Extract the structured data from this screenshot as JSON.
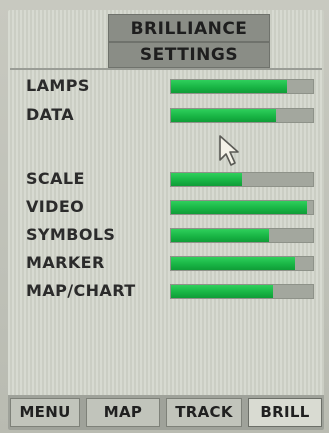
{
  "header": {
    "title_line1": "BRILLIANCE",
    "title_line2": "SETTINGS"
  },
  "settings": [
    {
      "label": "LAMPS",
      "level": 0.82
    },
    {
      "label": "DATA",
      "level": 0.74
    },
    {
      "label": "SCALE",
      "level": 0.5
    },
    {
      "label": "VIDEO",
      "level": 0.96
    },
    {
      "label": "SYMBOLS",
      "level": 0.69
    },
    {
      "label": "MARKER",
      "level": 0.87
    },
    {
      "label": "MAP/CHART",
      "level": 0.72
    }
  ],
  "tabs": [
    {
      "label": "MENU",
      "active": false
    },
    {
      "label": "MAP",
      "active": false
    },
    {
      "label": "TRACK",
      "active": false
    },
    {
      "label": "BRILL",
      "active": true
    }
  ],
  "colors": {
    "bar_fill": "#19b545",
    "bar_track": "#a3a79e",
    "title_bg": "#8a8d86"
  },
  "icons": {
    "cursor": "mouse-pointer-icon"
  }
}
